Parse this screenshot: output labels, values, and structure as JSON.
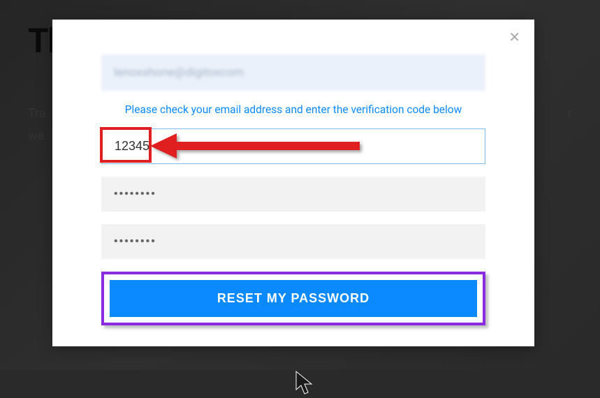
{
  "background": {
    "heading": "The future of analytics is here",
    "line1": "Tra",
    "line1_end": "r",
    "line2": "we",
    "line2_end": "."
  },
  "modal": {
    "email_display": "lenoxshone@digitoxcom",
    "instruction": "Please check your email address and enter the verification code below",
    "code_value": "12345",
    "pw1_value": "••••••••",
    "pw2_value": "••••••••",
    "submit_label": "RESET MY PASSWORD"
  },
  "annotations": {
    "arrow": "red-arrow",
    "highlight": "red-highlight-box",
    "purple_box": "purple-highlight-box"
  }
}
